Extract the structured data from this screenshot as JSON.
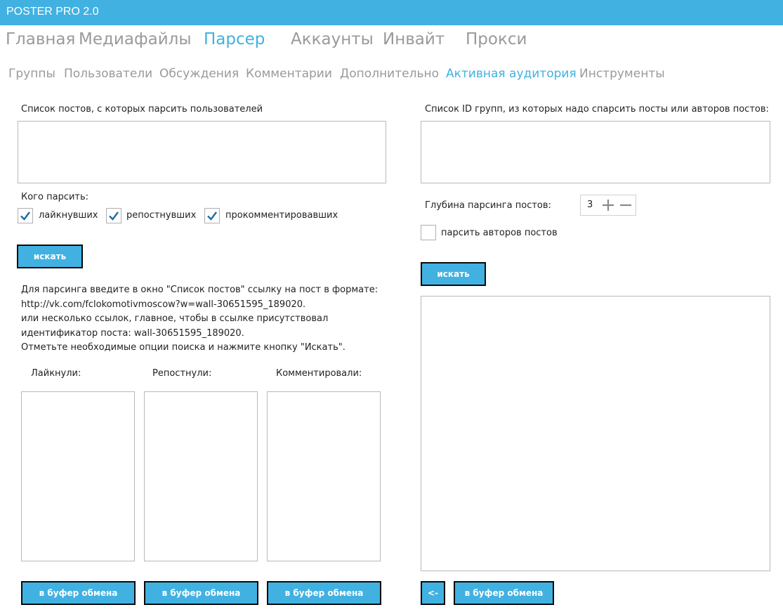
{
  "app": {
    "title": "POSTER PRO 2.0"
  },
  "menu": [
    {
      "label": "Главная",
      "active": false
    },
    {
      "label": "Медиафайлы",
      "active": false
    },
    {
      "label": "Парсер",
      "active": true
    },
    {
      "label": "Аккаунты",
      "active": false
    },
    {
      "label": "Инвайт",
      "active": false
    },
    {
      "label": "Прокси",
      "active": false
    }
  ],
  "submenu": [
    {
      "label": "Группы",
      "active": false
    },
    {
      "label": "Пользователи",
      "active": false
    },
    {
      "label": "Обсуждения",
      "active": false
    },
    {
      "label": "Комментарии",
      "active": false
    },
    {
      "label": "Дополнительно",
      "active": false
    },
    {
      "label": "Активная аудитория",
      "active": true
    },
    {
      "label": "Инструменты",
      "active": false
    }
  ],
  "left": {
    "posts_label": "Список постов, с которых парсить пользователей",
    "posts_value": "",
    "who_label": "Кого парсить:",
    "checkboxes": [
      {
        "label": "лайкнувших",
        "checked": true
      },
      {
        "label": "репостнувших",
        "checked": true
      },
      {
        "label": "прокомментировавших",
        "checked": true
      }
    ],
    "search_button": "искать",
    "help_lines": [
      "Для парсинга введите в окно \"Список постов\" ссылку на пост в формате:",
      "http://vk.com/fclokomotivmoscow?w=wall-30651595_189020.",
      "или несколько ссылок, главное, чтобы в ссылке присутствовал",
      "идентификатор поста: wall-30651595_189020.",
      "Отметьте необходимые опции поиска и нажмите кнопку \"Искать\"."
    ],
    "results": [
      {
        "label": "Лайкнули:",
        "button": "в буфер обмена"
      },
      {
        "label": "Репостнули:",
        "button": "в буфер обмена"
      },
      {
        "label": "Комментировали:",
        "button": "в буфер обмена"
      }
    ]
  },
  "right": {
    "groups_label": "Список ID групп, из которых надо спарсить посты или авторов постов:",
    "groups_value": "",
    "depth_label": "Глубина парсинга постов:",
    "depth_value": "3",
    "authors_checkbox": {
      "label": "парсить авторов постов",
      "checked": false
    },
    "search_button": "искать",
    "back_button": "<-",
    "copy_button": "в буфер обмена"
  },
  "colors": {
    "accent": "#41b1e1",
    "muted_text": "#9a9a9a",
    "button_border": "#0a0a0a"
  },
  "icons": {
    "check": "checkmark-icon",
    "plus": "plus-icon",
    "minus": "minus-icon"
  }
}
